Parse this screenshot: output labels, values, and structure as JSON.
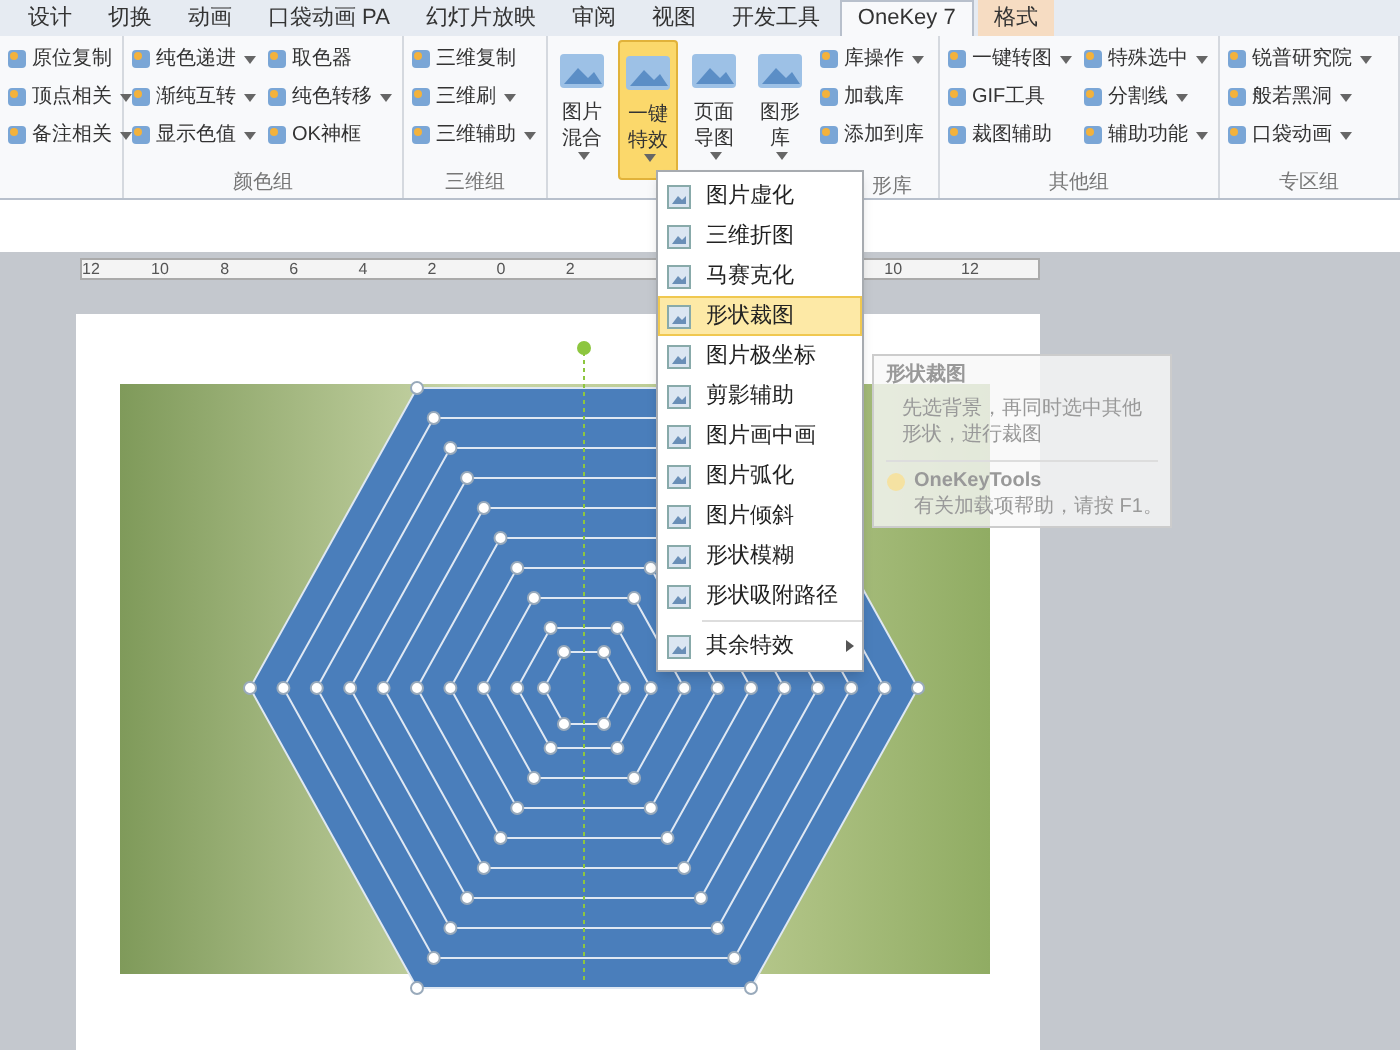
{
  "tabs": [
    {
      "label": "设计",
      "selected": false,
      "kind": "normal"
    },
    {
      "label": "切换",
      "selected": false,
      "kind": "normal"
    },
    {
      "label": "动画",
      "selected": false,
      "kind": "normal"
    },
    {
      "label": "口袋动画 PA",
      "selected": false,
      "kind": "normal"
    },
    {
      "label": "幻灯片放映",
      "selected": false,
      "kind": "normal"
    },
    {
      "label": "审阅",
      "selected": false,
      "kind": "normal"
    },
    {
      "label": "视图",
      "selected": false,
      "kind": "normal"
    },
    {
      "label": "开发工具",
      "selected": false,
      "kind": "normal"
    },
    {
      "label": "OneKey 7",
      "selected": true,
      "kind": "normal"
    },
    {
      "label": "格式",
      "selected": false,
      "kind": "context"
    }
  ],
  "ribbon_groups": [
    {
      "items": [
        {
          "kind": "column",
          "buttons": [
            {
              "label": "原位复制",
              "dropdown": false
            },
            {
              "label": "顶点相关",
              "dropdown": true
            },
            {
              "label": "备注相关",
              "dropdown": true
            }
          ]
        }
      ]
    },
    {
      "label": "颜色组",
      "items": [
        {
          "kind": "column",
          "buttons": [
            {
              "label": "纯色递进",
              "dropdown": true
            },
            {
              "label": "渐纯互转",
              "dropdown": true
            },
            {
              "label": "显示色值",
              "dropdown": true
            }
          ]
        },
        {
          "kind": "column",
          "buttons": [
            {
              "label": "取色器",
              "dropdown": false
            },
            {
              "label": "纯色转移",
              "dropdown": true
            },
            {
              "label": "OK神框",
              "dropdown": false
            }
          ]
        }
      ]
    },
    {
      "label": "三维组",
      "items": [
        {
          "kind": "column",
          "buttons": [
            {
              "label": "三维复制",
              "dropdown": false
            },
            {
              "label": "三维刷",
              "dropdown": true
            },
            {
              "label": "三维辅助",
              "dropdown": true
            }
          ]
        }
      ]
    },
    {
      "label": "形库",
      "items": [
        {
          "kind": "large",
          "label": "图片混合",
          "dropdown": true,
          "selected": false
        },
        {
          "kind": "large",
          "label": "一键特效",
          "dropdown": true,
          "selected": true
        },
        {
          "kind": "large",
          "label": "页面导图",
          "dropdown": true,
          "selected": false
        },
        {
          "kind": "large",
          "label": "图形库",
          "dropdown": true,
          "selected": false
        },
        {
          "kind": "column",
          "buttons": [
            {
              "label": "库操作",
              "dropdown": true
            },
            {
              "label": "加载库",
              "dropdown": false
            },
            {
              "label": "添加到库",
              "dropdown": false
            }
          ]
        }
      ]
    },
    {
      "label": "其他组",
      "items": [
        {
          "kind": "column",
          "buttons": [
            {
              "label": "一键转图",
              "dropdown": true
            },
            {
              "label": "GIF工具",
              "dropdown": false
            },
            {
              "label": "裁图辅助",
              "dropdown": false
            }
          ]
        },
        {
          "kind": "column",
          "buttons": [
            {
              "label": "特殊选中",
              "dropdown": true
            },
            {
              "label": "分割线",
              "dropdown": true
            },
            {
              "label": "辅助功能",
              "dropdown": true
            }
          ]
        }
      ]
    },
    {
      "label": "专区组",
      "items": [
        {
          "kind": "column",
          "buttons": [
            {
              "label": "锐普研究院",
              "dropdown": true
            },
            {
              "label": "般若黑洞",
              "dropdown": true
            },
            {
              "label": "口袋动画",
              "dropdown": true
            }
          ]
        }
      ]
    }
  ],
  "ruler": {
    "left_numbers": [
      "12",
      "10",
      "8",
      "6",
      "4",
      "2",
      "0",
      "2"
    ],
    "right_numbers": [
      "10",
      "12"
    ]
  },
  "menu": {
    "items": [
      {
        "label": "图片虚化",
        "kind": "item",
        "selected": false
      },
      {
        "label": "三维折图",
        "kind": "item",
        "selected": false
      },
      {
        "label": "马赛克化",
        "kind": "item",
        "selected": false
      },
      {
        "label": "形状裁图",
        "kind": "item",
        "selected": true
      },
      {
        "label": "图片极坐标",
        "kind": "item",
        "selected": false
      },
      {
        "label": "剪影辅助",
        "kind": "item",
        "selected": false
      },
      {
        "label": "图片画中画",
        "kind": "item",
        "selected": false
      },
      {
        "label": "图片弧化",
        "kind": "item",
        "selected": false
      },
      {
        "label": "图片倾斜",
        "kind": "item",
        "selected": false
      },
      {
        "label": "形状模糊",
        "kind": "item",
        "selected": false
      },
      {
        "label": "形状吸附路径",
        "kind": "item",
        "selected": false
      },
      {
        "label": "其余特效",
        "kind": "submenu",
        "selected": false
      }
    ]
  },
  "tooltip": {
    "title": "形状裁图",
    "body": "先选背景，再同时选中其他形状，进行裁图",
    "source": "OneKeyTools",
    "help": "有关加载项帮助，请按 F1。"
  }
}
